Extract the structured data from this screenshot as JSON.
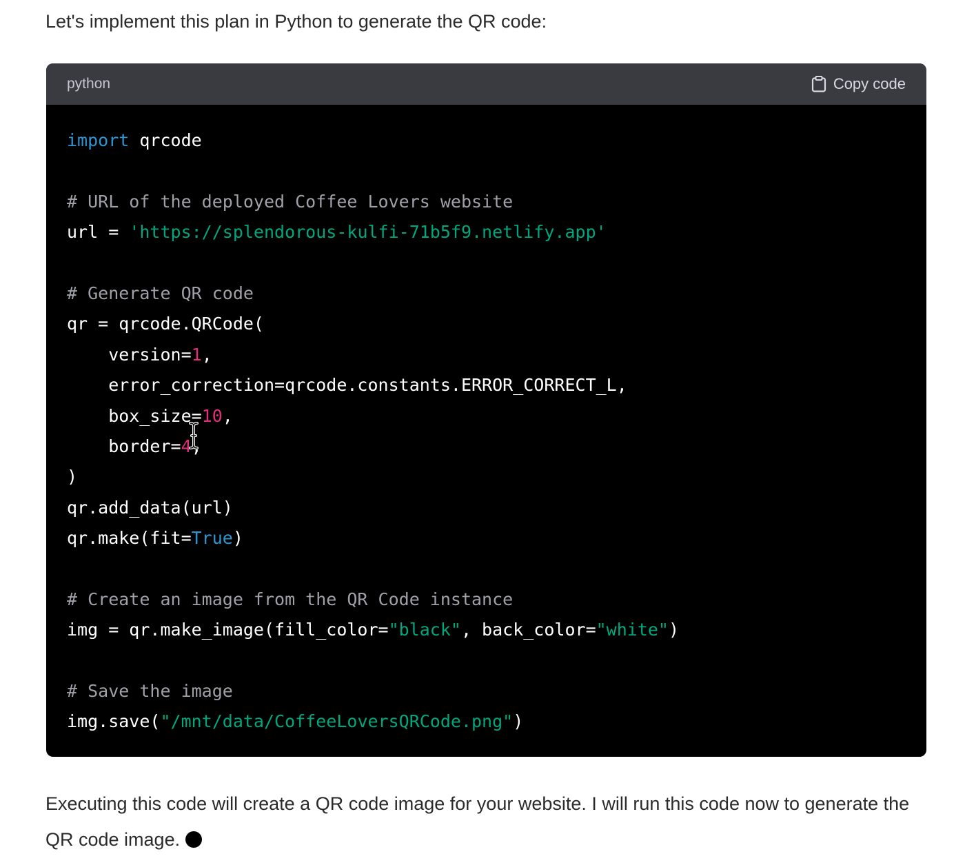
{
  "intro_text": "Let's implement this plan in Python to generate the QR code:",
  "code_block": {
    "language": "python",
    "copy_label": "Copy code",
    "lines": [
      [
        {
          "t": "import",
          "c": "kw"
        },
        {
          "t": " qrcode",
          "c": ""
        }
      ],
      [],
      [
        {
          "t": "# URL of the deployed Coffee Lovers website",
          "c": "cm"
        }
      ],
      [
        {
          "t": "url = ",
          "c": ""
        },
        {
          "t": "'https://splendorous-kulfi-71b5f9.netlify.app'",
          "c": "str"
        }
      ],
      [],
      [
        {
          "t": "# Generate QR code",
          "c": "cm"
        }
      ],
      [
        {
          "t": "qr = qrcode.QRCode(",
          "c": ""
        }
      ],
      [
        {
          "t": "    version=",
          "c": ""
        },
        {
          "t": "1",
          "c": "num"
        },
        {
          "t": ",",
          "c": ""
        }
      ],
      [
        {
          "t": "    error_correction=qrcode.constants.ERROR_CORRECT_L,",
          "c": ""
        }
      ],
      [
        {
          "t": "    box_size=",
          "c": ""
        },
        {
          "t": "10",
          "c": "num"
        },
        {
          "t": ",",
          "c": ""
        }
      ],
      [
        {
          "t": "    border=",
          "c": ""
        },
        {
          "t": "4",
          "c": "num"
        },
        {
          "t": ",",
          "c": ""
        }
      ],
      [
        {
          "t": ")",
          "c": ""
        }
      ],
      [
        {
          "t": "qr.add_data(url)",
          "c": ""
        }
      ],
      [
        {
          "t": "qr.make(fit=",
          "c": ""
        },
        {
          "t": "True",
          "c": "bool"
        },
        {
          "t": ")",
          "c": ""
        }
      ],
      [],
      [
        {
          "t": "# Create an image from the QR Code instance",
          "c": "cm"
        }
      ],
      [
        {
          "t": "img = qr.make_image(fill_color=",
          "c": ""
        },
        {
          "t": "\"black\"",
          "c": "str"
        },
        {
          "t": ", back_color=",
          "c": ""
        },
        {
          "t": "\"white\"",
          "c": "str"
        },
        {
          "t": ")",
          "c": ""
        }
      ],
      [],
      [
        {
          "t": "# Save the image",
          "c": "cm"
        }
      ],
      [
        {
          "t": "img.save(",
          "c": ""
        },
        {
          "t": "\"/mnt/data/CoffeeLoversQRCode.png\"",
          "c": "str"
        },
        {
          "t": ")",
          "c": ""
        }
      ]
    ]
  },
  "outro_text": "Executing this code will create a QR code image for your website. I will run this code now to generate the QR code image.",
  "colors": {
    "code_background": "#000000",
    "header_background": "#3a3b40",
    "keyword": "#2e95d3",
    "comment": "#a0a0a8",
    "string": "#00a67d",
    "number": "#df3079"
  },
  "icons": {
    "copy": "clipboard-icon",
    "typing_indicator": "dot",
    "mouse_cursor": "text-cursor"
  }
}
